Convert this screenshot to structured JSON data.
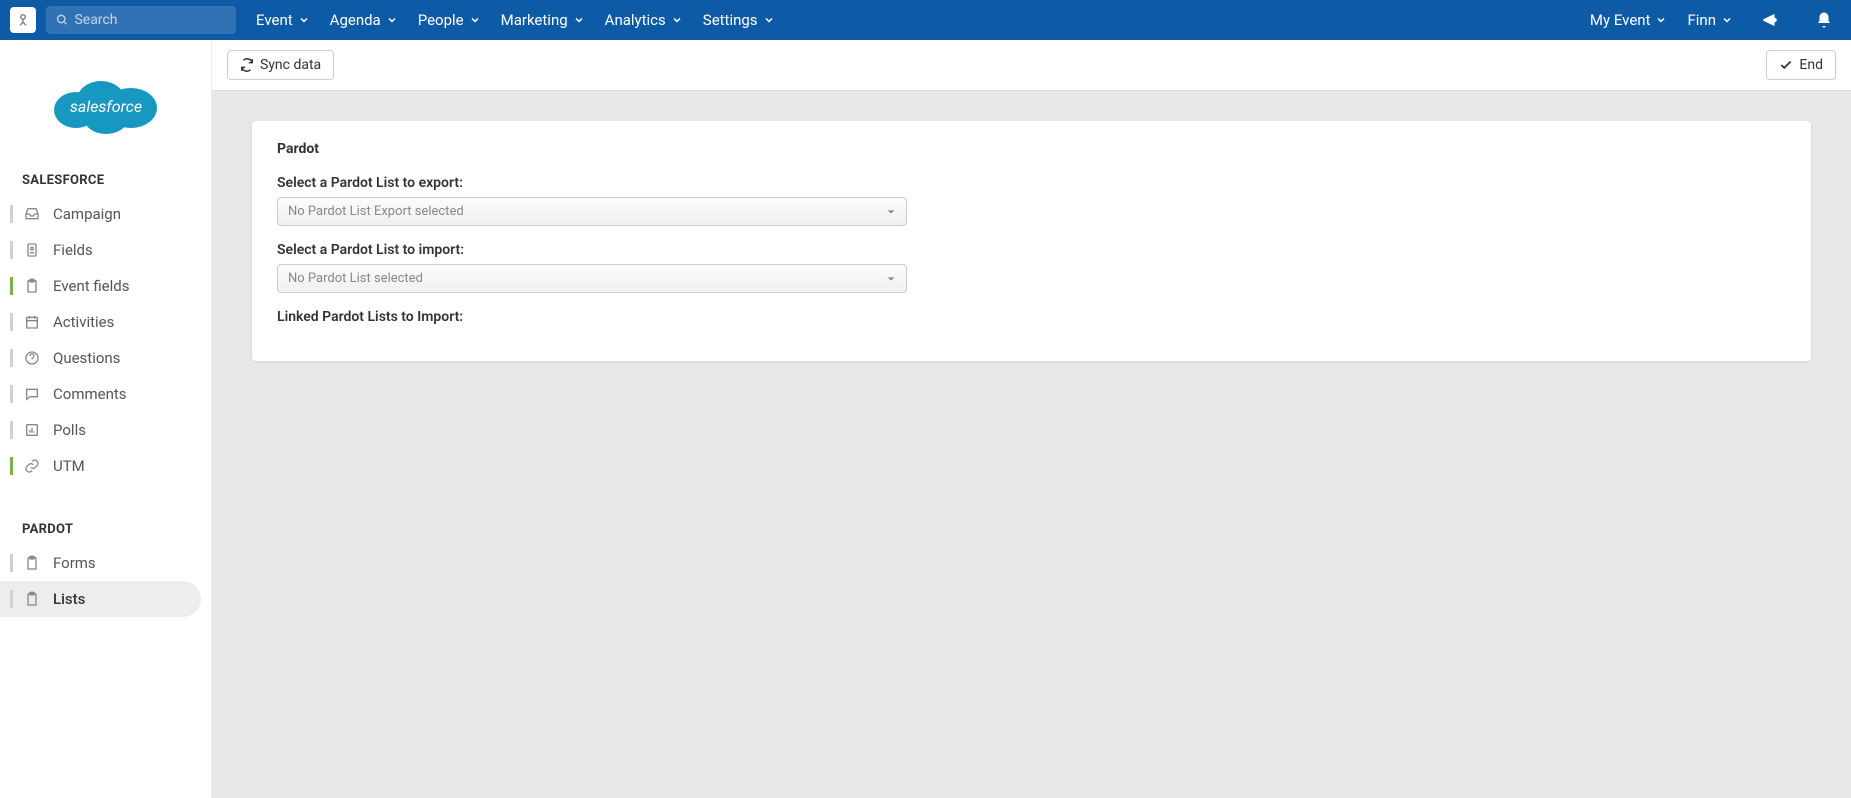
{
  "topbar": {
    "search_placeholder": "Search",
    "nav": [
      "Event",
      "Agenda",
      "People",
      "Marketing",
      "Analytics",
      "Settings"
    ],
    "right": {
      "my_event": "My Event",
      "user": "Finn"
    }
  },
  "sidebar": {
    "section1": {
      "title": "SALESFORCE"
    },
    "salesforce_items": [
      {
        "label": "Campaign",
        "icon": "inbox",
        "accent": "grey"
      },
      {
        "label": "Fields",
        "icon": "id",
        "accent": "grey"
      },
      {
        "label": "Event fields",
        "icon": "clipboard",
        "accent": "green"
      },
      {
        "label": "Activities",
        "icon": "calendar",
        "accent": "grey"
      },
      {
        "label": "Questions",
        "icon": "question",
        "accent": "grey"
      },
      {
        "label": "Comments",
        "icon": "comment",
        "accent": "grey"
      },
      {
        "label": "Polls",
        "icon": "chart",
        "accent": "grey"
      },
      {
        "label": "UTM",
        "icon": "link",
        "accent": "green"
      }
    ],
    "section2": {
      "title": "PARDOT"
    },
    "pardot_items": [
      {
        "label": "Forms",
        "icon": "clipboard",
        "accent": "grey"
      },
      {
        "label": "Lists",
        "icon": "clipboard",
        "accent": "grey",
        "active": true
      }
    ]
  },
  "toolbar": {
    "sync_label": "Sync data",
    "end_label": "End"
  },
  "card": {
    "title": "Pardot",
    "export_label": "Select a Pardot List to export:",
    "export_placeholder": "No Pardot List Export selected",
    "import_label": "Select a Pardot List to import:",
    "import_placeholder": "No Pardot List selected",
    "linked_label": "Linked Pardot Lists to Import:"
  }
}
